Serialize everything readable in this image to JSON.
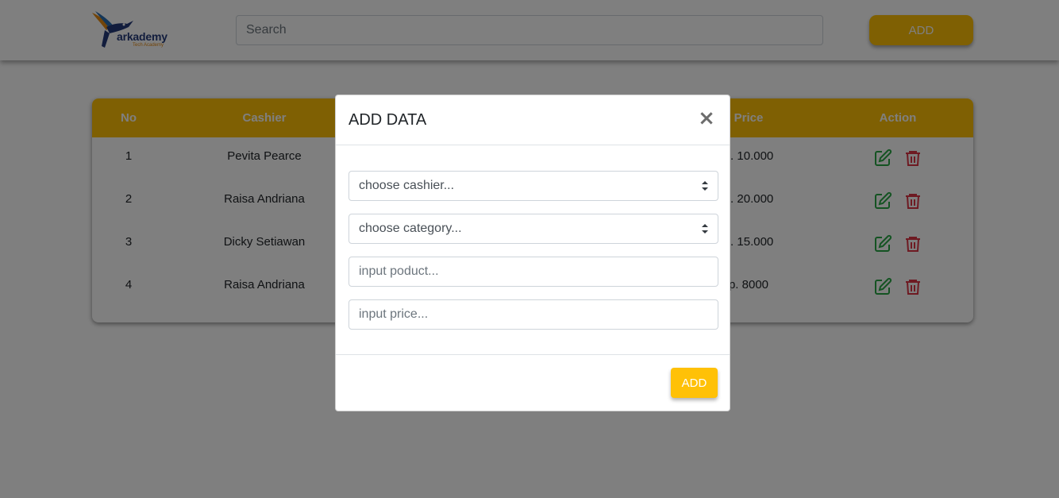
{
  "navbar": {
    "logo_text": "arkademy",
    "logo_subtext": "Tech Academy",
    "search_placeholder": "Search",
    "add_label": "ADD"
  },
  "table": {
    "headers": [
      "No",
      "Cashier",
      "",
      "",
      "Price",
      "Action"
    ],
    "rows": [
      {
        "no": "1",
        "cashier": "Pevita Pearce",
        "price": "p. 10.000"
      },
      {
        "no": "2",
        "cashier": "Raisa Andriana",
        "price": "p. 20.000"
      },
      {
        "no": "3",
        "cashier": "Dicky Setiawan",
        "price": "p. 15.000"
      },
      {
        "no": "4",
        "cashier": "Raisa Andriana",
        "price": "p. 8000"
      }
    ]
  },
  "modal": {
    "title": "ADD DATA",
    "close_label": "×",
    "cashier_select": "choose cashier...",
    "category_select": "choose category...",
    "product_placeholder": "input poduct...",
    "price_placeholder": "input price...",
    "submit_label": "ADD"
  },
  "colors": {
    "accent": "#ffc107",
    "edit_icon": "#28a745",
    "delete_icon": "#dc3545",
    "brand_navy": "#243a7a",
    "brand_orange": "#e58a12"
  },
  "icons": {
    "edit": "edit-icon",
    "delete": "trash-icon",
    "close": "close-icon",
    "select": "select-arrows-icon"
  }
}
